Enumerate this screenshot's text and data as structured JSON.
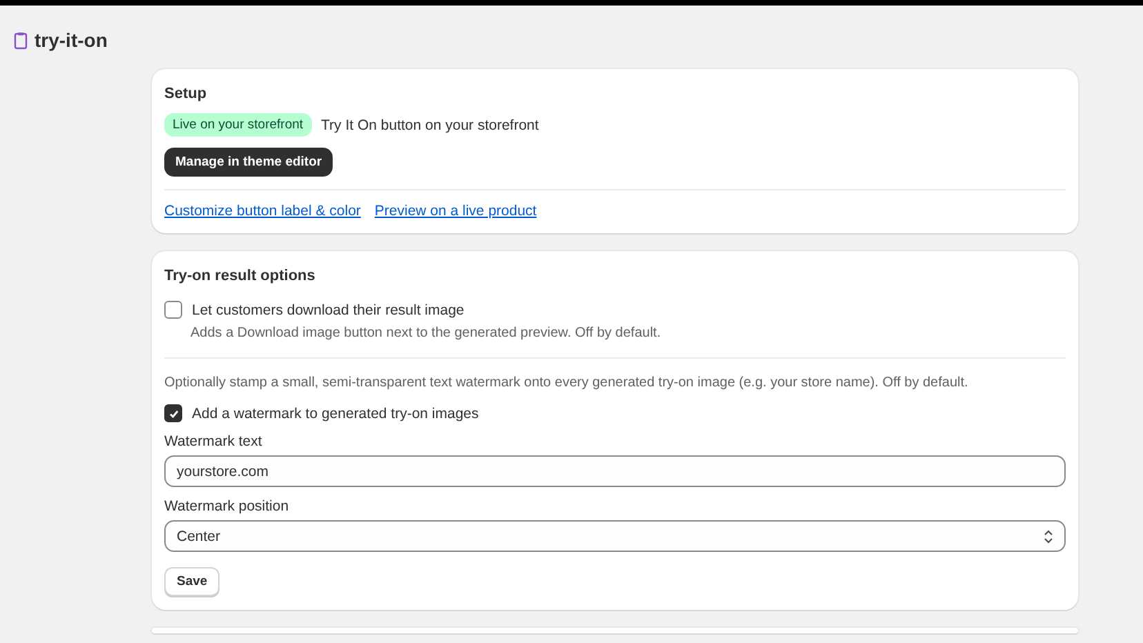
{
  "app": {
    "title": "try-it-on"
  },
  "setup": {
    "title": "Setup",
    "badge": "Live on your storefront",
    "status_text": "Try It On button on your storefront",
    "button": "Manage in theme editor",
    "links": [
      "Customize button label & color",
      "Preview on a live product"
    ]
  },
  "result_options": {
    "title": "Try-on result options",
    "download": {
      "label": "Let customers download their result image",
      "checked": false,
      "help": "Adds a Download image button next to the generated preview. Off by default."
    },
    "watermark_intro": "Optionally stamp a small, semi-transparent text watermark onto every generated try-on image (e.g. your store name). Off by default.",
    "watermark": {
      "label": "Add a watermark to generated try-on images",
      "checked": true
    },
    "text_field": {
      "label": "Watermark text",
      "value": "yourstore.com"
    },
    "position_field": {
      "label": "Watermark position",
      "value": "Center"
    },
    "save": "Save"
  }
}
